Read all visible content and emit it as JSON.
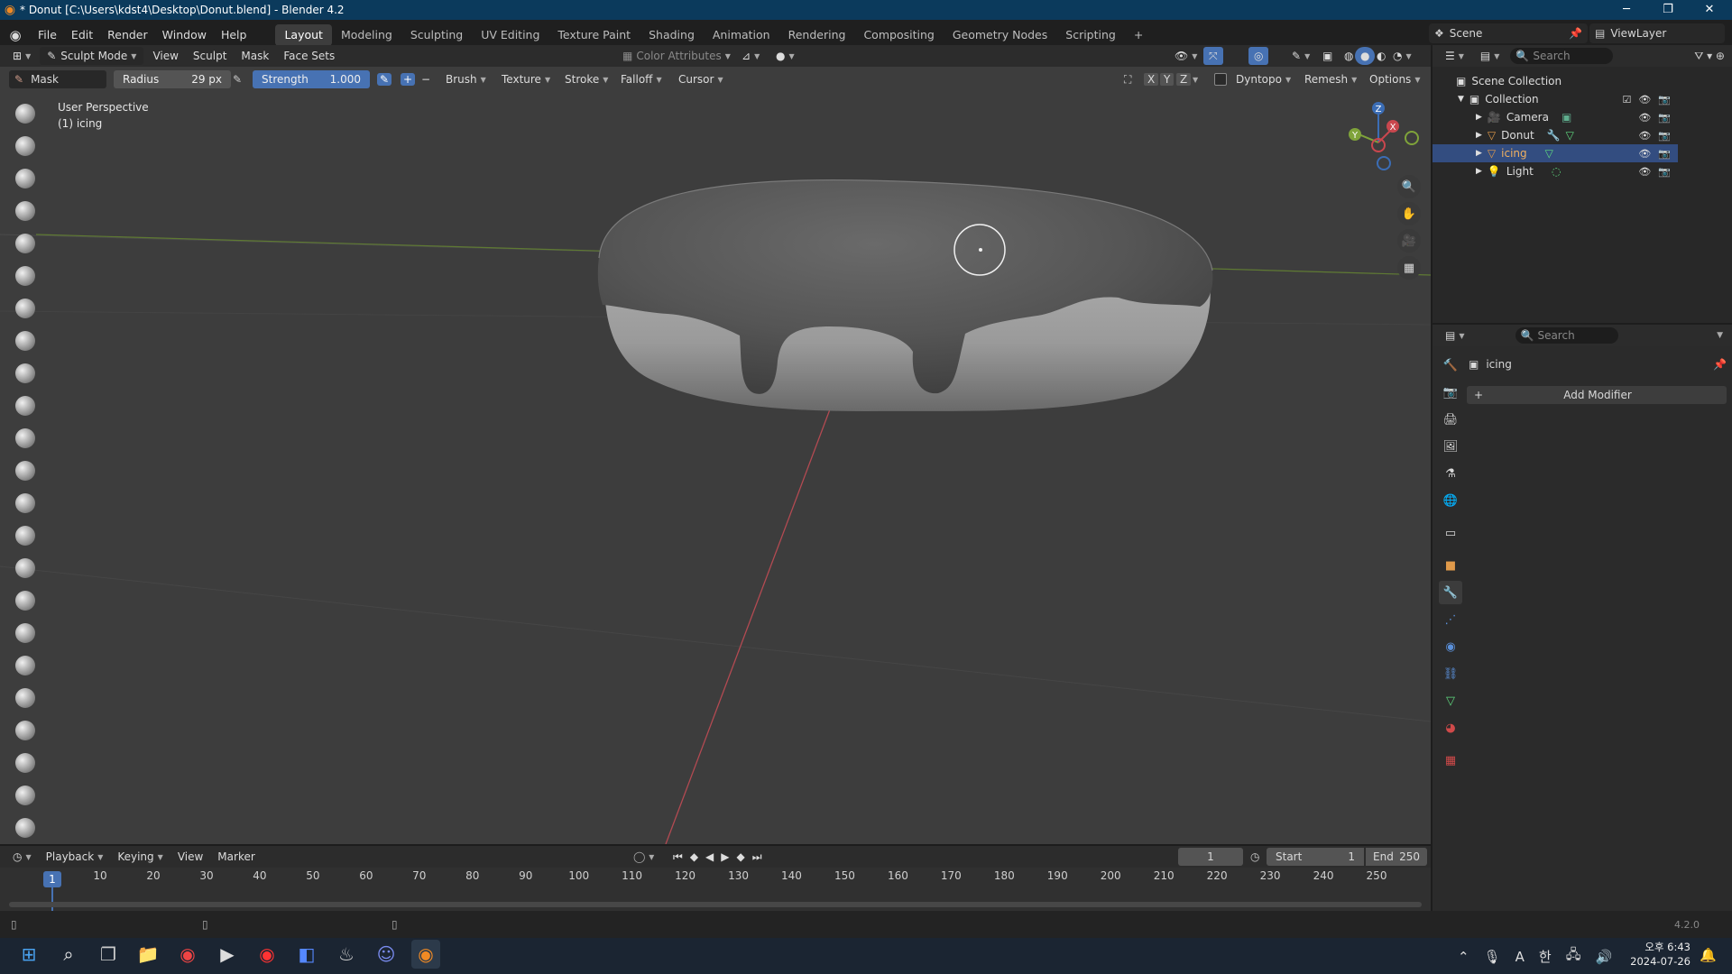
{
  "window": {
    "title": "* Donut [C:\\Users\\kdst4\\Desktop\\Donut.blend] - Blender 4.2"
  },
  "menu": {
    "items": [
      "File",
      "Edit",
      "Render",
      "Window",
      "Help"
    ]
  },
  "workspaces": {
    "tabs": [
      "Layout",
      "Modeling",
      "Sculpting",
      "UV Editing",
      "Texture Paint",
      "Shading",
      "Animation",
      "Rendering",
      "Compositing",
      "Geometry Nodes",
      "Scripting"
    ],
    "active": "Layout",
    "add": "+"
  },
  "scene": {
    "name": "Scene",
    "view_layer": "ViewLayer"
  },
  "viewport_header": {
    "mode": "Sculpt Mode",
    "menus": [
      "View",
      "Sculpt",
      "Mask",
      "Face Sets"
    ],
    "color_attributes": "Color Attributes"
  },
  "tool_settings": {
    "brush_name": "Mask",
    "radius_label": "Radius",
    "radius_value": "29 px",
    "strength_label": "Strength",
    "strength_value": "1.000",
    "plus": "+",
    "minus": "−",
    "menus": [
      "Brush",
      "Texture",
      "Stroke",
      "Falloff",
      "Cursor"
    ],
    "axes": [
      "X",
      "Y",
      "Z"
    ],
    "dyntopo": "Dyntopo",
    "remesh": "Remesh",
    "options": "Options"
  },
  "viewport": {
    "perspective": "User Perspective",
    "object": "(1) icing",
    "gizmo_axes": {
      "z": "Z",
      "y": "Y",
      "x": "X"
    }
  },
  "outliner": {
    "search_placeholder": "Search",
    "root": "Scene Collection",
    "collection": "Collection",
    "items": [
      {
        "name": "Camera",
        "type": "camera"
      },
      {
        "name": "Donut",
        "type": "mesh"
      },
      {
        "name": "icing",
        "type": "mesh"
      },
      {
        "name": "Light",
        "type": "light"
      }
    ],
    "selected": "icing"
  },
  "properties": {
    "search_placeholder": "Search",
    "object_name": "icing",
    "add_modifier": "Add Modifier"
  },
  "timeline": {
    "menus": [
      "Playback",
      "Keying",
      "View",
      "Marker"
    ],
    "current_frame": "1",
    "start_label": "Start",
    "start_value": "1",
    "end_label": "End",
    "end_value": "250",
    "ticks": [
      "1",
      "10",
      "20",
      "30",
      "40",
      "50",
      "60",
      "70",
      "80",
      "90",
      "100",
      "110",
      "120",
      "130",
      "140",
      "150",
      "160",
      "170",
      "180",
      "190",
      "200",
      "210",
      "220",
      "230",
      "240",
      "250"
    ]
  },
  "statusbar": {
    "version": "4.2.0"
  },
  "taskbar": {
    "time": "오후 6:43",
    "date": "2024-07-26",
    "ime": "A",
    "lang": "한"
  },
  "colors": {
    "accent": "#4772b3",
    "selection": "#334d80",
    "titlebar": "#0b3a5c",
    "axis_x": "#c9474e",
    "axis_y": "#7fa33a"
  }
}
